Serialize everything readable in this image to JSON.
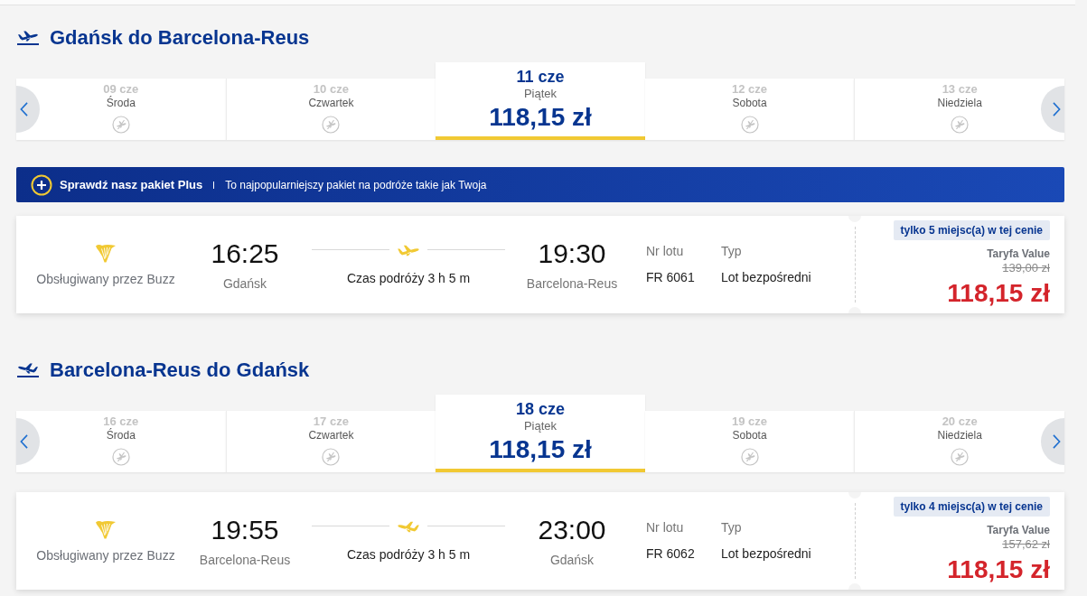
{
  "sections": [
    {
      "kind": "outbound",
      "title": "Gdańsk do Barcelona-Reus",
      "dates": [
        {
          "date": "09 cze",
          "day": "Środa",
          "available": false,
          "selected": false
        },
        {
          "date": "10 cze",
          "day": "Czwartek",
          "available": false,
          "selected": false
        },
        {
          "date": "11 cze",
          "day": "Piątek",
          "available": true,
          "price": "118,15 zł",
          "selected": true
        },
        {
          "date": "12 cze",
          "day": "Sobota",
          "available": false,
          "selected": false
        },
        {
          "date": "13 cze",
          "day": "Niedziela",
          "available": false,
          "selected": false
        }
      ],
      "promo": {
        "title": "Sprawdź nasz pakiet Plus",
        "text": "To najpopularniejszy pakiet na podróże takie jak Twoja"
      },
      "flights": [
        {
          "operator": "Obsługiwany przez Buzz",
          "departure": {
            "time": "16:25",
            "airport": "Gdańsk"
          },
          "duration": "Czas podróży 3 h 5 m",
          "arrival": {
            "time": "19:30",
            "airport": "Barcelona-Reus"
          },
          "flight_number": {
            "label": "Nr lotu",
            "value": "FR 6061"
          },
          "flight_type": {
            "label": "Typ",
            "value": "Lot bezpośredni"
          },
          "seats_note": "tylko 5 miejsc(a) w tej cenie",
          "fare": "Taryfa Value",
          "old_price": "139,00 zł",
          "price": "118,15 zł"
        }
      ]
    },
    {
      "kind": "return",
      "title": "Barcelona-Reus do Gdańsk",
      "dates": [
        {
          "date": "16 cze",
          "day": "Środa",
          "available": false,
          "selected": false
        },
        {
          "date": "17 cze",
          "day": "Czwartek",
          "available": false,
          "selected": false
        },
        {
          "date": "18 cze",
          "day": "Piątek",
          "available": true,
          "price": "118,15 zł",
          "selected": true
        },
        {
          "date": "19 cze",
          "day": "Sobota",
          "available": false,
          "selected": false
        },
        {
          "date": "20 cze",
          "day": "Niedziela",
          "available": false,
          "selected": false
        }
      ],
      "flights": [
        {
          "operator": "Obsługiwany przez Buzz",
          "departure": {
            "time": "19:55",
            "airport": "Barcelona-Reus"
          },
          "duration": "Czas podróży 3 h 5 m",
          "arrival": {
            "time": "23:00",
            "airport": "Gdańsk"
          },
          "flight_number": {
            "label": "Nr lotu",
            "value": "FR 6062"
          },
          "flight_type": {
            "label": "Typ",
            "value": "Lot bezpośredni"
          },
          "seats_note": "tylko 4 miejsc(a) w tej cenie",
          "fare": "Taryfa Value",
          "old_price": "157,62 zł",
          "price": "118,15 zł"
        }
      ]
    }
  ]
}
